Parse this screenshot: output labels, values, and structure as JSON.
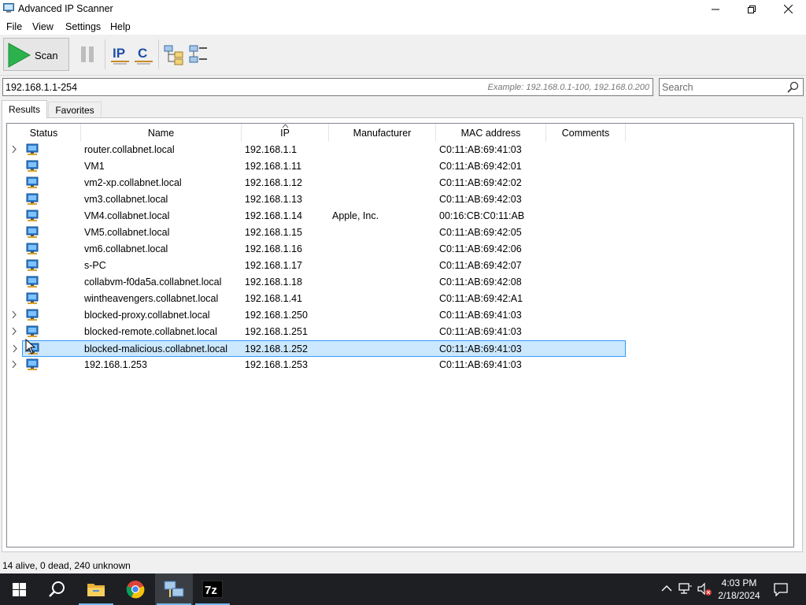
{
  "window": {
    "title": "Advanced IP Scanner"
  },
  "menu": [
    "File",
    "View",
    "Settings",
    "Help"
  ],
  "toolbar": {
    "scan_label": "Scan",
    "ip_label": "IP",
    "c_label": "C"
  },
  "address": {
    "value": "192.168.1.1-254",
    "example": "Example: 192.168.0.1-100, 192.168.0.200"
  },
  "search": {
    "placeholder": "Search"
  },
  "tabs": [
    {
      "label": "Results",
      "active": true
    },
    {
      "label": "Favorites",
      "active": false
    }
  ],
  "columns": [
    "Status",
    "Name",
    "IP",
    "Manufacturer",
    "MAC address",
    "Comments"
  ],
  "rows": [
    {
      "expandable": true,
      "name": "router.collabnet.local",
      "ip": "192.168.1.1",
      "manufacturer": "",
      "mac": "C0:11:AB:69:41:03"
    },
    {
      "expandable": false,
      "name": "VM1",
      "ip": "192.168.1.11",
      "manufacturer": "",
      "mac": "C0:11:AB:69:42:01"
    },
    {
      "expandable": false,
      "name": "vm2-xp.collabnet.local",
      "ip": "192.168.1.12",
      "manufacturer": "",
      "mac": "C0:11:AB:69:42:02"
    },
    {
      "expandable": false,
      "name": "vm3.collabnet.local",
      "ip": "192.168.1.13",
      "manufacturer": "",
      "mac": "C0:11:AB:69:42:03"
    },
    {
      "expandable": false,
      "name": "VM4.collabnet.local",
      "ip": "192.168.1.14",
      "manufacturer": "Apple, Inc.",
      "mac": "00:16:CB:C0:11:AB"
    },
    {
      "expandable": false,
      "name": "VM5.collabnet.local",
      "ip": "192.168.1.15",
      "manufacturer": "",
      "mac": "C0:11:AB:69:42:05"
    },
    {
      "expandable": false,
      "name": "vm6.collabnet.local",
      "ip": "192.168.1.16",
      "manufacturer": "",
      "mac": "C0:11:AB:69:42:06"
    },
    {
      "expandable": false,
      "name": "s-PC",
      "ip": "192.168.1.17",
      "manufacturer": "",
      "mac": "C0:11:AB:69:42:07"
    },
    {
      "expandable": false,
      "name": "collabvm-f0da5a.collabnet.local",
      "ip": "192.168.1.18",
      "manufacturer": "",
      "mac": "C0:11:AB:69:42:08"
    },
    {
      "expandable": false,
      "name": "wintheavengers.collabnet.local",
      "ip": "192.168.1.41",
      "manufacturer": "",
      "mac": "C0:11:AB:69:42:A1"
    },
    {
      "expandable": true,
      "name": "blocked-proxy.collabnet.local",
      "ip": "192.168.1.250",
      "manufacturer": "",
      "mac": "C0:11:AB:69:41:03"
    },
    {
      "expandable": true,
      "name": "blocked-remote.collabnet.local",
      "ip": "192.168.1.251",
      "manufacturer": "",
      "mac": "C0:11:AB:69:41:03"
    },
    {
      "expandable": true,
      "name": "blocked-malicious.collabnet.local",
      "ip": "192.168.1.252",
      "manufacturer": "",
      "mac": "C0:11:AB:69:41:03",
      "selected": true
    },
    {
      "expandable": true,
      "name": "192.168.1.253",
      "ip": "192.168.1.253",
      "manufacturer": "",
      "mac": "C0:11:AB:69:41:03"
    }
  ],
  "status": {
    "text": "14 alive, 0 dead, 240 unknown"
  },
  "taskbar": {
    "time": "4:03 PM",
    "date": "2/18/2024",
    "apps": [
      "start-icon",
      "search-icon",
      "file-explorer-icon",
      "chrome-icon",
      "advanced-ip-scanner-icon",
      "7zip-icon"
    ],
    "sevenzip_label": "7z"
  },
  "colors": {
    "selection": "#cce8ff",
    "selection_border": "#3399ff",
    "scan_green": "#2bb24c",
    "taskbar": "#1d1f23"
  }
}
